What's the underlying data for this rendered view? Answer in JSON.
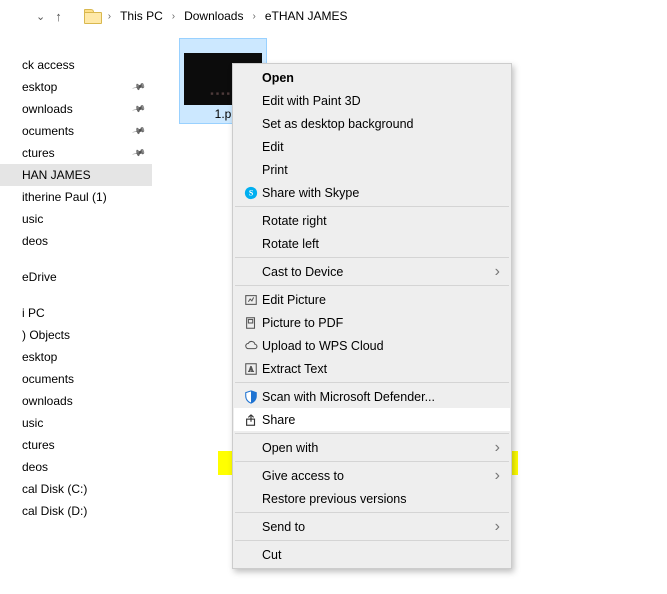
{
  "breadcrumb": {
    "segments": [
      "This PC",
      "Downloads",
      "eTHAN JAMES"
    ]
  },
  "nav": {
    "items": [
      {
        "label": "ck access",
        "pinned": false
      },
      {
        "label": "esktop",
        "pinned": true
      },
      {
        "label": "ownloads",
        "pinned": true
      },
      {
        "label": "ocuments",
        "pinned": true
      },
      {
        "label": "ctures",
        "pinned": true
      },
      {
        "label": "HAN JAMES",
        "pinned": false,
        "selected": true
      },
      {
        "label": "itherine Paul (1)",
        "pinned": false
      },
      {
        "label": "usic",
        "pinned": false
      },
      {
        "label": "deos",
        "pinned": false
      },
      {
        "label": "eDrive",
        "pinned": false,
        "gapBefore": true
      },
      {
        "label": "i PC",
        "pinned": false,
        "gapBefore": true
      },
      {
        "label": ") Objects",
        "pinned": false
      },
      {
        "label": "esktop",
        "pinned": false
      },
      {
        "label": "ocuments",
        "pinned": false
      },
      {
        "label": "ownloads",
        "pinned": false
      },
      {
        "label": "usic",
        "pinned": false
      },
      {
        "label": "ctures",
        "pinned": false
      },
      {
        "label": "deos",
        "pinned": false
      },
      {
        "label": "cal Disk (C:)",
        "pinned": false
      },
      {
        "label": "cal Disk (D:)",
        "pinned": false
      }
    ]
  },
  "file": {
    "name": "1.p"
  },
  "menu": {
    "items": [
      {
        "label": "Open",
        "bold": true
      },
      {
        "label": "Edit with Paint 3D"
      },
      {
        "label": "Set as desktop background"
      },
      {
        "label": "Edit"
      },
      {
        "label": "Print"
      },
      {
        "label": "Share with Skype",
        "icon": "skype"
      },
      {
        "sep": true
      },
      {
        "label": "Rotate right"
      },
      {
        "label": "Rotate left"
      },
      {
        "sep": true
      },
      {
        "label": "Cast to Device",
        "submenu": true
      },
      {
        "sep": true
      },
      {
        "label": "Edit Picture",
        "icon": "edit-picture"
      },
      {
        "label": "Picture to PDF",
        "icon": "picture-pdf"
      },
      {
        "label": "Upload to WPS Cloud",
        "icon": "cloud"
      },
      {
        "label": "Extract Text",
        "icon": "extract-text"
      },
      {
        "sep": true
      },
      {
        "label": "Scan with Microsoft Defender...",
        "icon": "defender"
      },
      {
        "label": "Share",
        "icon": "share",
        "highlight": true
      },
      {
        "sep": true
      },
      {
        "label": "Open with",
        "submenu": true
      },
      {
        "sep": true
      },
      {
        "label": "Give access to",
        "submenu": true
      },
      {
        "label": "Restore previous versions"
      },
      {
        "sep": true
      },
      {
        "label": "Send to",
        "submenu": true
      },
      {
        "sep": true
      },
      {
        "label": "Cut"
      }
    ]
  }
}
